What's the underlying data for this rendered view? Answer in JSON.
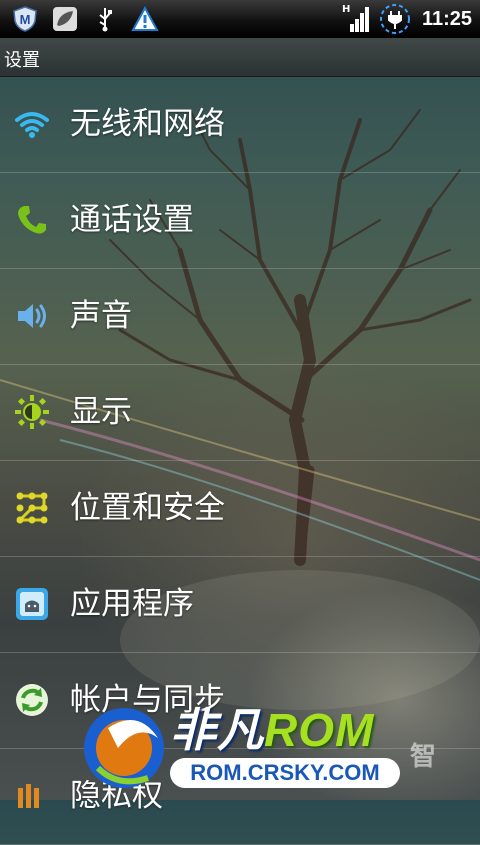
{
  "status_bar": {
    "left_icons": [
      "mcafee-icon",
      "leaf-icon",
      "usb-icon",
      "warning-icon"
    ],
    "right_icons": [
      "signal-icon",
      "charging-battery-icon"
    ],
    "network_type": "H",
    "time": "11:25"
  },
  "title_bar": {
    "title": "设置"
  },
  "settings": {
    "items": [
      {
        "label": "无线和网络",
        "icon": "wifi-icon"
      },
      {
        "label": "通话设置",
        "icon": "phone-icon"
      },
      {
        "label": "声音",
        "icon": "speaker-icon"
      },
      {
        "label": "显示",
        "icon": "brightness-icon"
      },
      {
        "label": "位置和安全",
        "icon": "pattern-lock-icon"
      },
      {
        "label": "应用程序",
        "icon": "android-app-icon"
      },
      {
        "label": "帐户与同步",
        "icon": "sync-icon"
      },
      {
        "label": "隐私权",
        "icon": "privacy-icon"
      }
    ]
  },
  "watermark": {
    "brand_cn": "非凡",
    "brand_rom": "ROM",
    "url": "ROM.CRSKY.COM",
    "side_text": "智"
  },
  "colors": {
    "wifi": "#3ab8f0",
    "phone": "#7ac21a",
    "display": "#a6d41a",
    "status_bar": "#000000"
  }
}
